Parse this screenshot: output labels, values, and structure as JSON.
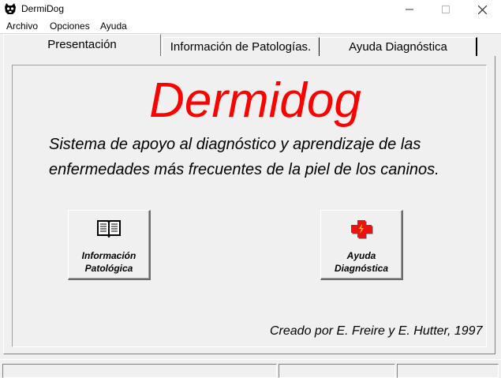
{
  "window": {
    "title": "DermiDog"
  },
  "menu": {
    "items": [
      "Archivo",
      "Opciones",
      "Ayuda"
    ]
  },
  "tabs": [
    {
      "label": "Presentación",
      "active": true
    },
    {
      "label": "Información de Patologías.",
      "active": false
    },
    {
      "label": "Ayuda Diagnóstica",
      "active": false
    }
  ],
  "presentation": {
    "app_name": "Dermidog",
    "subtitle_line1": "Sistema de apoyo al diagnóstico y aprendizaje de las",
    "subtitle_line2": "enfermedades más frecuentes de la piel de los caninos.",
    "buttons": {
      "info": {
        "line1": "Información",
        "line2": "Patológica",
        "icon": "book-icon"
      },
      "ayuda": {
        "line1": "Ayuda",
        "line2": "Diagnóstica",
        "icon": "red-cross-icon"
      }
    },
    "credits": "Creado por E. Freire y E. Hutter, 1997"
  },
  "colors": {
    "title_red": "#ff0000",
    "cross_red": "#ee1111",
    "cross_yellow": "#ffe000",
    "face": "#f0f0f0"
  }
}
